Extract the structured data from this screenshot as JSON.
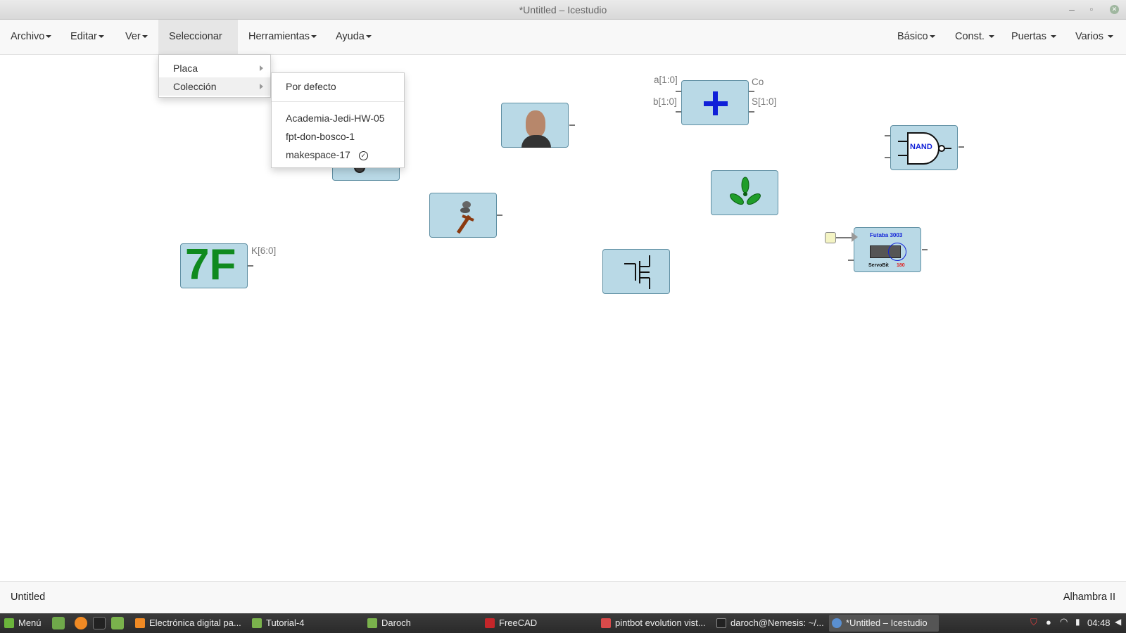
{
  "window": {
    "title": "*Untitled – Icestudio"
  },
  "menubar": {
    "left": [
      {
        "label": "Archivo"
      },
      {
        "label": "Editar"
      },
      {
        "label": "Ver"
      },
      {
        "label": "Seleccionar"
      },
      {
        "label": "Herramientas"
      },
      {
        "label": "Ayuda"
      }
    ],
    "right": [
      {
        "label": "Básico"
      },
      {
        "label": "Const."
      },
      {
        "label": "Puertas"
      },
      {
        "label": "Varios"
      }
    ]
  },
  "select_menu": {
    "items": [
      {
        "label": "Placa"
      },
      {
        "label": "Colección"
      }
    ],
    "collection_submenu": {
      "default": "Por defecto",
      "items": [
        {
          "label": "Academia-Jedi-HW-05"
        },
        {
          "label": "fpt-don-bosco-1"
        },
        {
          "label": "makespace-17",
          "checked": true
        }
      ]
    }
  },
  "canvas": {
    "const_value": "7F",
    "const_port": "K[6:0]",
    "adder_ports": {
      "a": "a[1:0]",
      "b": "b[1:0]",
      "co": "Co",
      "s": "S[1:0]"
    },
    "nand_label": "NAND",
    "servo": {
      "top": "Futaba 3003",
      "bottom": "ServoBit",
      "value": "180"
    }
  },
  "statusbar": {
    "file": "Untitled",
    "board": "Alhambra II"
  },
  "taskbar": {
    "menu_label": "Menú",
    "tasks": [
      {
        "label": "Electrónica digital pa..."
      },
      {
        "label": "Tutorial-4"
      },
      {
        "label": "Daroch"
      },
      {
        "label": "FreeCAD"
      },
      {
        "label": "pintbot evolution vist..."
      },
      {
        "label": "daroch@Nemesis: ~/..."
      },
      {
        "label": "*Untitled – Icestudio"
      }
    ],
    "clock": "04:48"
  },
  "colors": {
    "block_fill": "#b9d9e6",
    "block_border": "#5f8fa3",
    "const_green": "#0f8a1e",
    "adder_blue": "#1020d8"
  }
}
